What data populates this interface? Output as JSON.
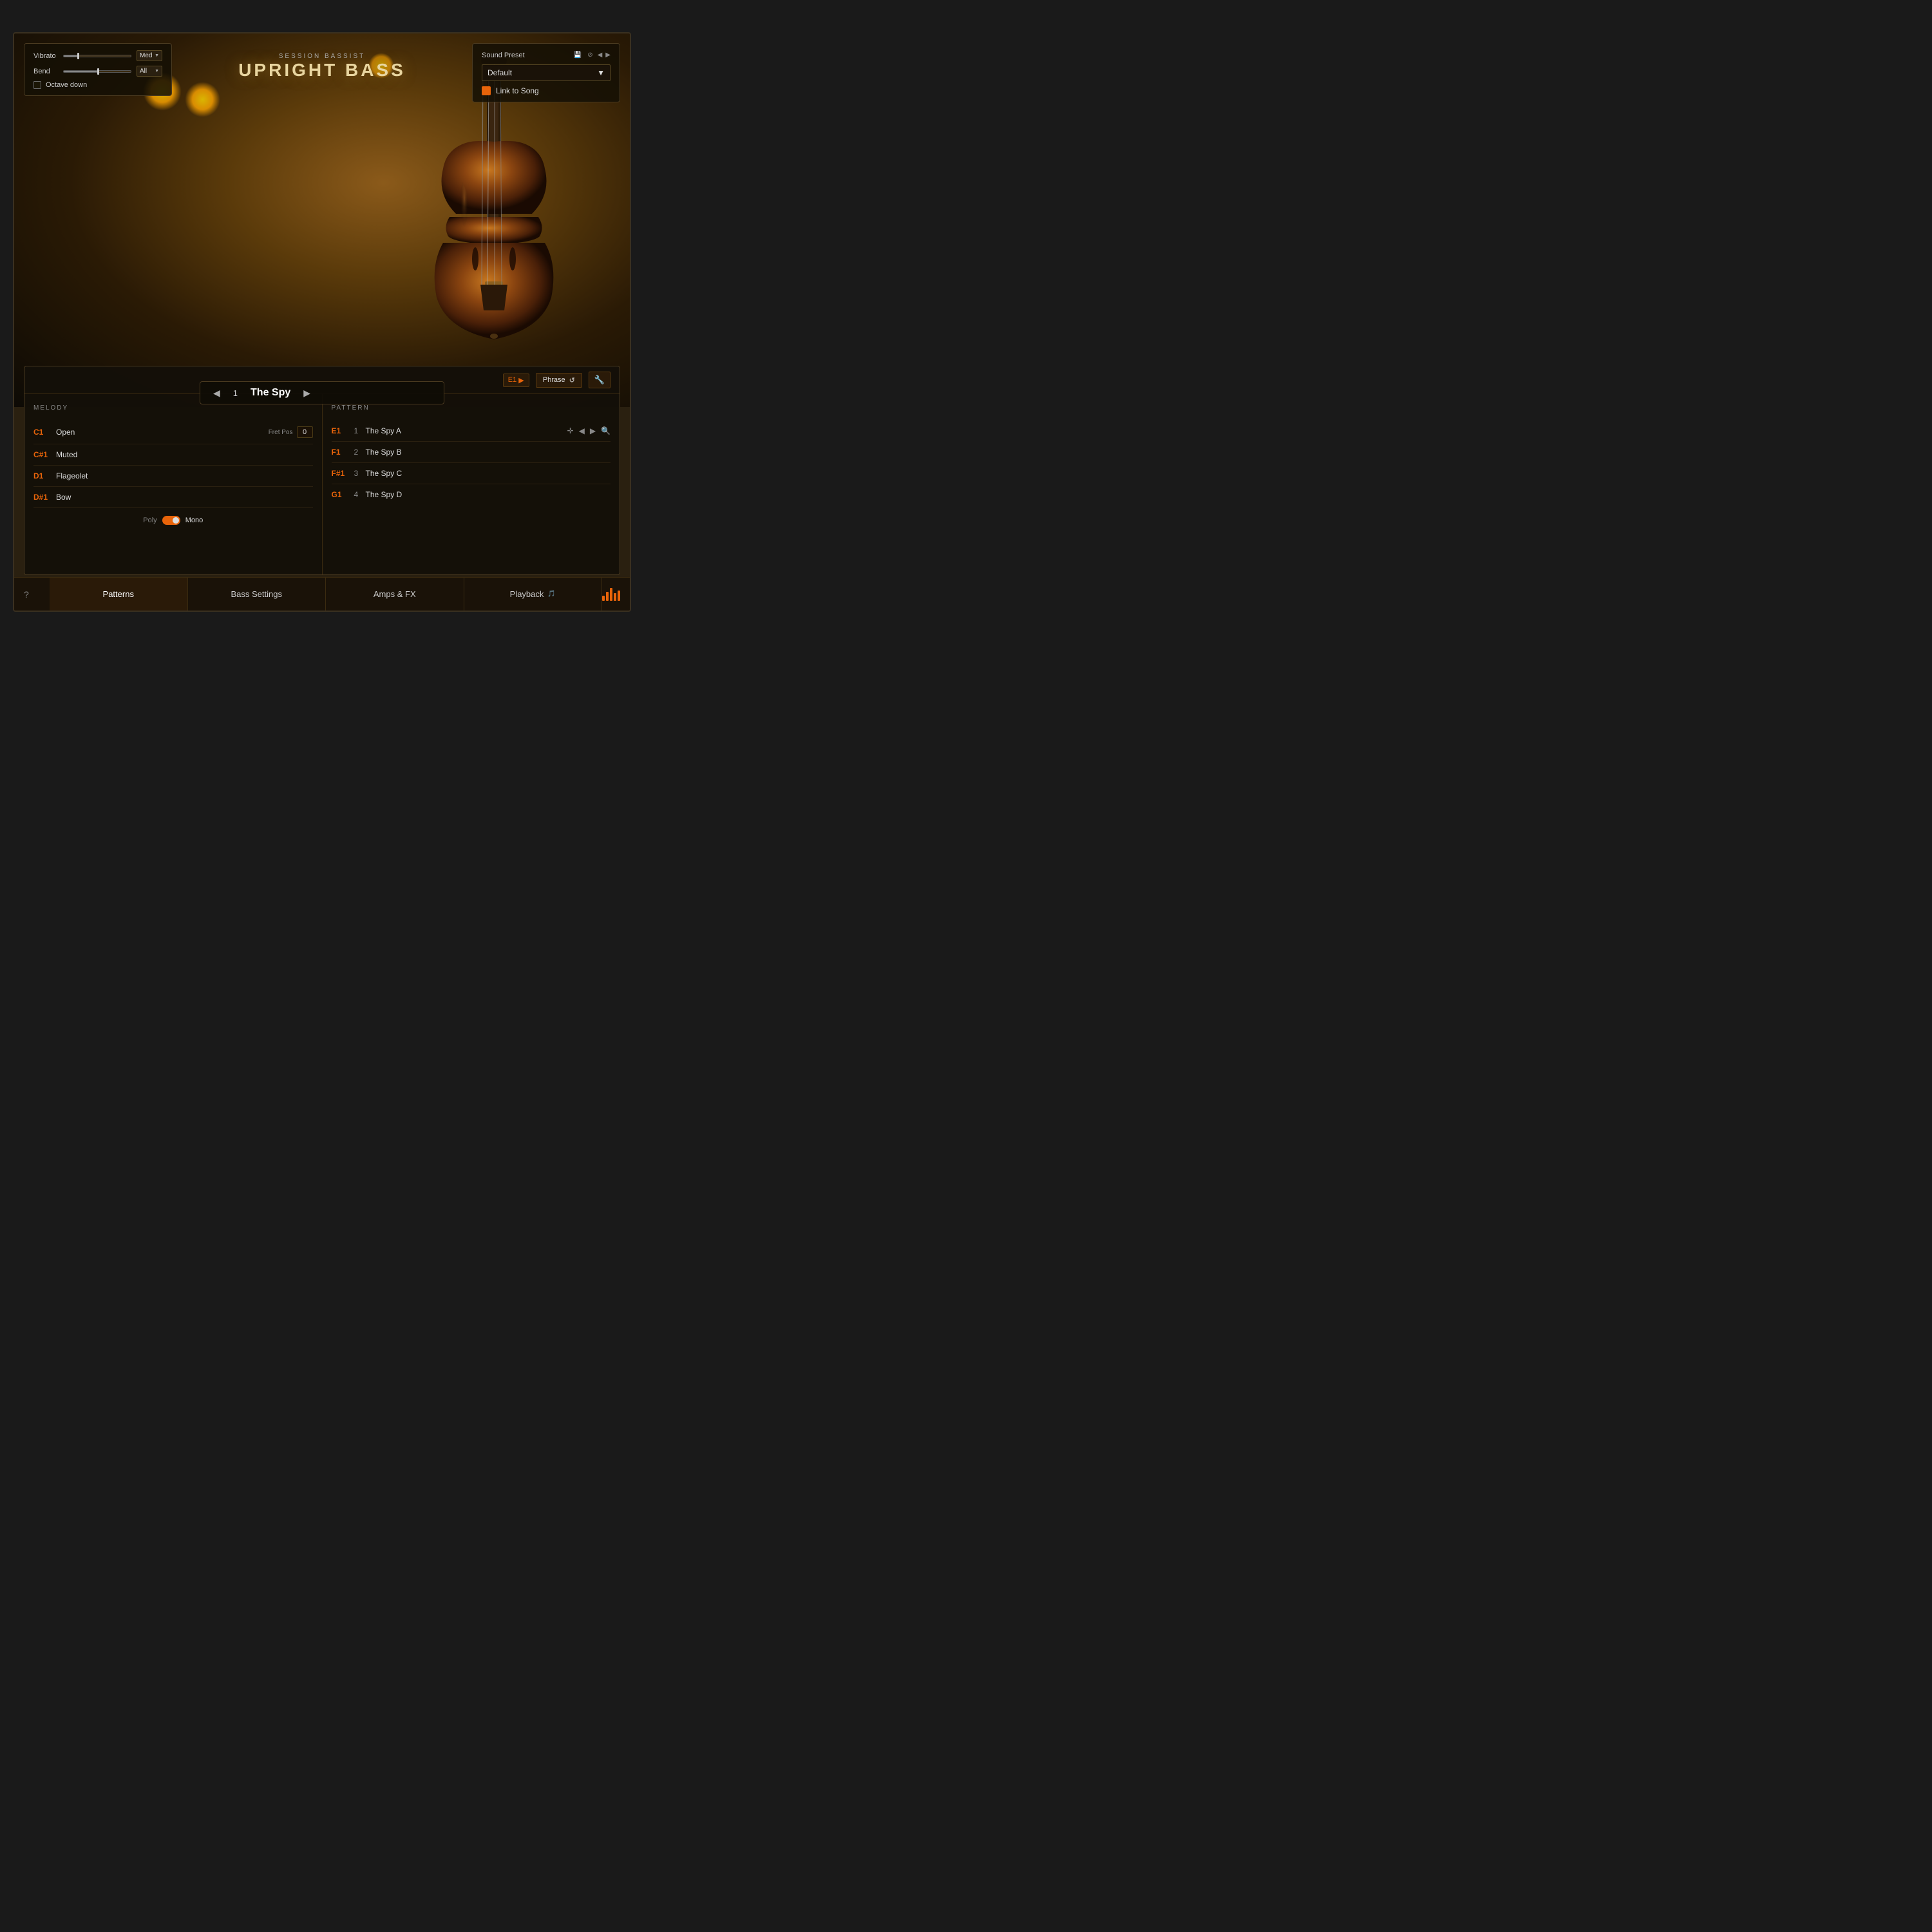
{
  "app": {
    "title": "Session Bassist - Upright Bass"
  },
  "header": {
    "session_bassist": "SESSION BASSIST",
    "instrument_name": "UPRIGHT BASS"
  },
  "top_controls": {
    "vibrato_label": "Vibrato",
    "vibrato_value": "Med",
    "bend_label": "Bend",
    "bend_value": "All",
    "octave_label": "Octave down",
    "vibrato_fill_pct": 20,
    "bend_fill_pct": 50
  },
  "sound_preset": {
    "label": "Sound Preset",
    "value": "Default",
    "link_to_song_label": "Link to Song"
  },
  "song_selector": {
    "number": "1",
    "name": "The Spy"
  },
  "pattern_bar": {
    "key": "E1",
    "mode_label": "Phrase",
    "wrench_icon": "⚙"
  },
  "melody_section": {
    "title": "MELODY",
    "rows": [
      {
        "key": "C1",
        "name": "Open",
        "show_fret": true,
        "fret_label": "Fret Pos",
        "fret_value": "0"
      },
      {
        "key": "C#1",
        "name": "Muted",
        "show_fret": false
      },
      {
        "key": "D1",
        "name": "Flageolet",
        "show_fret": false
      },
      {
        "key": "D#1",
        "name": "Bow",
        "show_fret": false
      }
    ],
    "poly_label": "Poly",
    "mono_label": "Mono"
  },
  "pattern_section": {
    "title": "PATTERN",
    "rows": [
      {
        "key": "E1",
        "number": "1",
        "name": "The Spy A"
      },
      {
        "key": "F1",
        "number": "2",
        "name": "The Spy B"
      },
      {
        "key": "F#1",
        "number": "3",
        "name": "The Spy C"
      },
      {
        "key": "G1",
        "number": "4",
        "name": "The Spy D"
      }
    ]
  },
  "bottom_nav": {
    "help_label": "?",
    "tabs": [
      {
        "id": "patterns",
        "label": "Patterns",
        "active": true
      },
      {
        "id": "bass-settings",
        "label": "Bass Settings",
        "active": false
      },
      {
        "id": "amps-fx",
        "label": "Amps & FX",
        "active": false
      },
      {
        "id": "playback",
        "label": "Playback",
        "active": false
      }
    ],
    "playback_icon": "🎵"
  }
}
